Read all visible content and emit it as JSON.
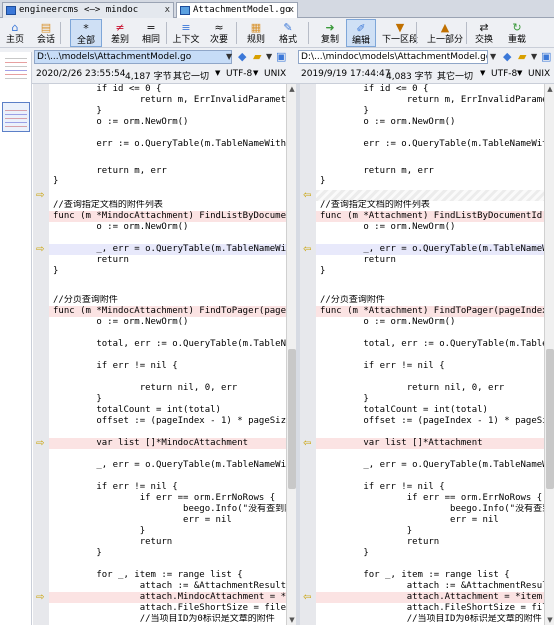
{
  "tabs": [
    {
      "label": "engineercms <—> mindoc",
      "active": false,
      "close": "x"
    },
    {
      "label": "AttachmentModel.go",
      "active": true,
      "close": "x"
    }
  ],
  "toolbar": {
    "buttons": [
      {
        "label": "主页",
        "icon": "home-icon",
        "glyph": "⌂",
        "color": "#3b78d8"
      },
      {
        "label": "会话",
        "icon": "session-icon",
        "glyph": "▤",
        "color": "#d8912a"
      },
      {
        "label": "全部",
        "icon": "all-icon",
        "glyph": "*",
        "color": "#111"
      },
      {
        "label": "差别",
        "icon": "diff-icon",
        "glyph": "≠",
        "color": "#c8102e"
      },
      {
        "label": "相同",
        "icon": "same-icon",
        "glyph": "=",
        "color": "#111"
      },
      {
        "label": "上下文",
        "icon": "context-icon",
        "glyph": "≡",
        "color": "#3b78d8"
      },
      {
        "label": "次要",
        "icon": "minor-icon",
        "glyph": "≈",
        "color": "#111"
      },
      {
        "label": "规则",
        "icon": "rules-icon",
        "glyph": "▦",
        "color": "#d8912a"
      },
      {
        "label": "格式",
        "icon": "format-icon",
        "glyph": "✎",
        "color": "#3b78d8"
      },
      {
        "label": "复制",
        "icon": "copy-icon",
        "glyph": "➜",
        "color": "#3b9a3b"
      },
      {
        "label": "编辑",
        "icon": "edit-icon",
        "glyph": "✐",
        "color": "#3b78d8"
      },
      {
        "label": "下一区段",
        "icon": "next-section-icon",
        "glyph": "▼",
        "color": "#c07000"
      },
      {
        "label": "上一部分",
        "icon": "prev-part-icon",
        "glyph": "▲",
        "color": "#c07000"
      },
      {
        "label": "交换",
        "icon": "swap-icon",
        "glyph": "⇄",
        "color": "#111"
      },
      {
        "label": "重载",
        "icon": "reload-icon",
        "glyph": "↻",
        "color": "#3b9a3b"
      }
    ]
  },
  "left": {
    "path": "D:\\...\\models\\AttachmentModel.go",
    "date": "2020/2/26 23:55:54",
    "size": "4,187 字节",
    "other": "其它一切",
    "encoding": "UTF-8",
    "eol": "UNIX",
    "lines": [
      {
        "text": "        if id <= 0 {",
        "type": "",
        "arrow": ""
      },
      {
        "text": "                return m, ErrInvalidParameter",
        "type": "",
        "arrow": ""
      },
      {
        "text": "        }",
        "type": "",
        "arrow": ""
      },
      {
        "text": "        o := orm.NewOrm()",
        "type": "",
        "arrow": ""
      },
      {
        "text": "",
        "type": "",
        "arrow": ""
      },
      {
        "text": "        err := o.QueryTable(m.TableNameWithPre",
        "type": "",
        "arrow": ""
      },
      {
        "text": "",
        "type": "",
        "arrow": ""
      },
      {
        "text": "        return m, err",
        "type": "",
        "arrow": ""
      },
      {
        "text": "}",
        "type": "",
        "arrow": ""
      },
      {
        "text": "",
        "type": "",
        "arrow": "⇨"
      },
      {
        "text": "//查询指定文档的附件列表",
        "type": "",
        "arrow": ""
      },
      {
        "text": "func (m *MindocAttachment) FindListByDocumentI",
        "type": "del",
        "arrow": ""
      },
      {
        "text": "        o := orm.NewOrm()",
        "type": "",
        "arrow": ""
      },
      {
        "text": "",
        "type": "",
        "arrow": ""
      },
      {
        "text": "        _, err = o.QueryTable(m.TableNameWithP",
        "type": "chg",
        "arrow": "⇨"
      },
      {
        "text": "        return",
        "type": "",
        "arrow": ""
      },
      {
        "text": "}",
        "type": "",
        "arrow": ""
      },
      {
        "text": "",
        "type": "",
        "arrow": ""
      },
      {
        "text": "//分页查询附件",
        "type": "",
        "arrow": ""
      },
      {
        "text": "func (m *MindocAttachment) FindToPager(pageInd",
        "type": "del",
        "arrow": ""
      },
      {
        "text": "        o := orm.NewOrm()",
        "type": "",
        "arrow": ""
      },
      {
        "text": "",
        "type": "",
        "arrow": ""
      },
      {
        "text": "        total, err := o.QueryTable(m.TableName",
        "type": "",
        "arrow": ""
      },
      {
        "text": "",
        "type": "",
        "arrow": ""
      },
      {
        "text": "        if err != nil {",
        "type": "",
        "arrow": ""
      },
      {
        "text": "",
        "type": "",
        "arrow": ""
      },
      {
        "text": "                return nil, 0, err",
        "type": "",
        "arrow": ""
      },
      {
        "text": "        }",
        "type": "",
        "arrow": ""
      },
      {
        "text": "        totalCount = int(total)",
        "type": "",
        "arrow": ""
      },
      {
        "text": "        offset := (pageIndex - 1) * pageSize",
        "type": "",
        "arrow": ""
      },
      {
        "text": "",
        "type": "",
        "arrow": ""
      },
      {
        "text": "        var list []*MindocAttachment",
        "type": "del",
        "arrow": "⇨"
      },
      {
        "text": "",
        "type": "",
        "arrow": ""
      },
      {
        "text": "        _, err = o.QueryTable(m.TableNameWithP",
        "type": "",
        "arrow": ""
      },
      {
        "text": "",
        "type": "",
        "arrow": ""
      },
      {
        "text": "        if err != nil {",
        "type": "",
        "arrow": ""
      },
      {
        "text": "                if err == orm.ErrNoRows {",
        "type": "",
        "arrow": ""
      },
      {
        "text": "                        beego.Info(\"没有查到附",
        "type": "",
        "arrow": ""
      },
      {
        "text": "                        err = nil",
        "type": "",
        "arrow": ""
      },
      {
        "text": "                }",
        "type": "",
        "arrow": ""
      },
      {
        "text": "                return",
        "type": "",
        "arrow": ""
      },
      {
        "text": "        }",
        "type": "",
        "arrow": ""
      },
      {
        "text": "",
        "type": "",
        "arrow": ""
      },
      {
        "text": "        for _, item := range list {",
        "type": "",
        "arrow": ""
      },
      {
        "text": "                attach := &AttachmentResult{}",
        "type": "",
        "arrow": ""
      },
      {
        "text": "                attach.MindocAttachment = *ite",
        "type": "del",
        "arrow": "⇨"
      },
      {
        "text": "                attach.FileShortSize = fileti",
        "type": "",
        "arrow": ""
      },
      {
        "text": "                //当项目ID为0标识是文章的附件",
        "type": "",
        "arrow": ""
      }
    ]
  },
  "right": {
    "path": "D:\\...\\mindoc\\models\\AttachmentModel.go",
    "date": "2019/9/19 17:44:47",
    "size": "4,083 字节",
    "other": "其它一切",
    "encoding": "UTF-8",
    "eol": "UNIX",
    "lines": [
      {
        "text": "        if id <= 0 {",
        "type": "",
        "arrow": ""
      },
      {
        "text": "                return m, ErrInvalidParameter",
        "type": "",
        "arrow": ""
      },
      {
        "text": "        }",
        "type": "",
        "arrow": ""
      },
      {
        "text": "        o := orm.NewOrm()",
        "type": "",
        "arrow": ""
      },
      {
        "text": "",
        "type": "",
        "arrow": ""
      },
      {
        "text": "        err := o.QueryTable(m.TableNameWithPre",
        "type": "",
        "arrow": ""
      },
      {
        "text": "",
        "type": "",
        "arrow": ""
      },
      {
        "text": "        return m, err",
        "type": "",
        "arrow": ""
      },
      {
        "text": "}",
        "type": "",
        "arrow": ""
      },
      {
        "text": "",
        "type": "gap",
        "arrow": "⇦"
      },
      {
        "text": "//查询指定文档的附件列表",
        "type": "",
        "arrow": ""
      },
      {
        "text": "func (m *Attachment) FindListByDocumentId(doc",
        "type": "del",
        "arrow": ""
      },
      {
        "text": "        o := orm.NewOrm()",
        "type": "",
        "arrow": ""
      },
      {
        "text": "",
        "type": "",
        "arrow": ""
      },
      {
        "text": "        _, err = o.QueryTable(m.TableNameWithP",
        "type": "chg",
        "arrow": "⇦"
      },
      {
        "text": "        return",
        "type": "",
        "arrow": ""
      },
      {
        "text": "}",
        "type": "",
        "arrow": ""
      },
      {
        "text": "",
        "type": "",
        "arrow": ""
      },
      {
        "text": "//分页查询附件",
        "type": "",
        "arrow": ""
      },
      {
        "text": "func (m *Attachment) FindToPager(pageIndex, pa",
        "type": "del",
        "arrow": ""
      },
      {
        "text": "        o := orm.NewOrm()",
        "type": "",
        "arrow": ""
      },
      {
        "text": "",
        "type": "",
        "arrow": ""
      },
      {
        "text": "        total, err := o.QueryTable(m.TableName",
        "type": "",
        "arrow": ""
      },
      {
        "text": "",
        "type": "",
        "arrow": ""
      },
      {
        "text": "        if err != nil {",
        "type": "",
        "arrow": ""
      },
      {
        "text": "",
        "type": "",
        "arrow": ""
      },
      {
        "text": "                return nil, 0, err",
        "type": "",
        "arrow": ""
      },
      {
        "text": "        }",
        "type": "",
        "arrow": ""
      },
      {
        "text": "        totalCount = int(total)",
        "type": "",
        "arrow": ""
      },
      {
        "text": "        offset := (pageIndex - 1) * pageSize",
        "type": "",
        "arrow": ""
      },
      {
        "text": "",
        "type": "",
        "arrow": ""
      },
      {
        "text": "        var list []*Attachment",
        "type": "del",
        "arrow": "⇦"
      },
      {
        "text": "",
        "type": "",
        "arrow": ""
      },
      {
        "text": "        _, err = o.QueryTable(m.TableNameWithP",
        "type": "",
        "arrow": ""
      },
      {
        "text": "",
        "type": "",
        "arrow": ""
      },
      {
        "text": "        if err != nil {",
        "type": "",
        "arrow": ""
      },
      {
        "text": "                if err == orm.ErrNoRows {",
        "type": "",
        "arrow": ""
      },
      {
        "text": "                        beego.Info(\"没有查到附",
        "type": "",
        "arrow": ""
      },
      {
        "text": "                        err = nil",
        "type": "",
        "arrow": ""
      },
      {
        "text": "                }",
        "type": "",
        "arrow": ""
      },
      {
        "text": "                return",
        "type": "",
        "arrow": ""
      },
      {
        "text": "        }",
        "type": "",
        "arrow": ""
      },
      {
        "text": "",
        "type": "",
        "arrow": ""
      },
      {
        "text": "        for _, item := range list {",
        "type": "",
        "arrow": ""
      },
      {
        "text": "                attach := &AttachmentResult{}",
        "type": "",
        "arrow": ""
      },
      {
        "text": "                attach.Attachment = *item",
        "type": "del",
        "arrow": "⇦"
      },
      {
        "text": "                attach.FileShortSize = fileti",
        "type": "",
        "arrow": ""
      },
      {
        "text": "                //当项目ID为0标识是文章的附件",
        "type": "",
        "arrow": ""
      }
    ]
  }
}
